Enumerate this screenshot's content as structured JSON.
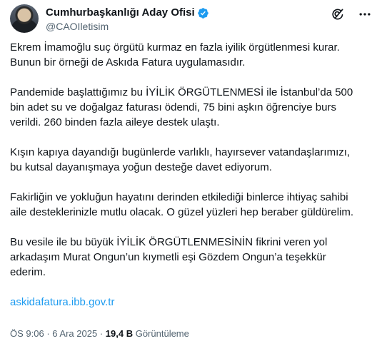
{
  "author": {
    "display_name": "Cumhurbaşkanlığı Aday Ofisi",
    "handle": "@CAOIletisim",
    "verified_color": "#1d9bf0"
  },
  "actions": {
    "grok_icon": "grok-icon",
    "more_icon": "more-icon"
  },
  "tweet": {
    "paragraphs": [
      "Ekrem İmamoğlu suç örgütü kurmaz en fazla iyilik örgütlenmesi kurar.\nBunun bir örneği de Askıda Fatura uygulamasıdır.",
      "Pandemide başlattığımız bu İYİLİK ÖRGÜTLENMESİ ile İstanbul’da 500\nbin adet su ve doğalgaz faturası ödendi, 75 bini aşkın öğrenciye burs\nverildi. 260 binden fazla aileye destek ulaştı.",
      "Kışın kapıya dayandığı bugünlerde varlıklı, hayırsever vatandaşlarımızı,\nbu kutsal dayanışmaya yoğun desteğe davet ediyorum.",
      "Fakirliğin ve yokluğun hayatını derinden etkilediği binlerce ihtiyaç sahibi\naile desteklerinizle mutlu olacak. O güzel yüzleri hep beraber güldürelim.",
      "Bu vesile ile bu büyük İYİLİK ÖRGÜTLENMESİNİN fikrini veren yol\narkadaşım Murat Ongun’un kıymetli eşi Gözdem Ongun’a teşekkür\nederim."
    ],
    "link": "askidafatura.ibb.gov.tr",
    "link_color": "#1d9bf0"
  },
  "meta": {
    "time": "ÖS 9:06",
    "separator": "·",
    "date": "6 Ara 2025",
    "views_count": "19,4 B",
    "views_label": "Görüntüleme"
  }
}
